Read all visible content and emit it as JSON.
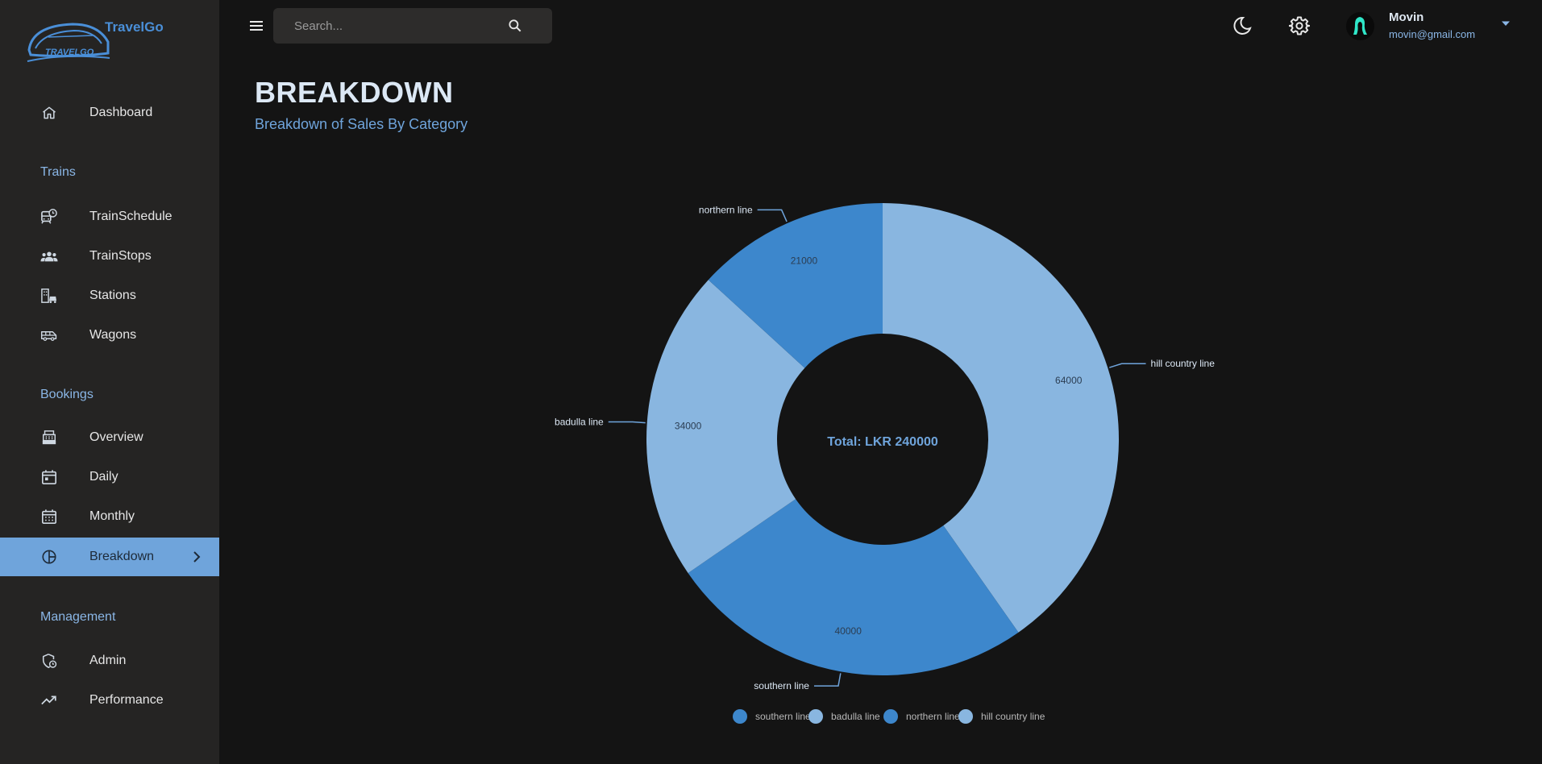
{
  "app": {
    "name": "TravelGo",
    "logo_text": "TRAVELGO"
  },
  "search": {
    "placeholder": "Search..."
  },
  "user": {
    "name": "Movin",
    "email": "movin@gmail.com"
  },
  "sidebar": {
    "dashboard": "Dashboard",
    "sections": {
      "trains": "Trains",
      "bookings": "Bookings",
      "management": "Management"
    },
    "trains_items": [
      "TrainSchedule",
      "TrainStops",
      "Stations",
      "Wagons"
    ],
    "bookings_items": [
      "Overview",
      "Daily",
      "Monthly",
      "Breakdown"
    ],
    "management_items": [
      "Admin",
      "Performance"
    ],
    "active": "Breakdown"
  },
  "header": {
    "title": "BREAKDOWN",
    "subtitle": "Breakdown of Sales By Category"
  },
  "colors": {
    "accent": "#6fa4db",
    "slice_dark": "#3d87cc",
    "slice_light": "#89b6e0",
    "background": "#141414",
    "sidebar": "#252423"
  },
  "chart_data": {
    "type": "pie",
    "donut": true,
    "center_label": "Total: LKR 240000",
    "slices": [
      {
        "label": "hill country line",
        "value": 64000,
        "color": "#89b6e0"
      },
      {
        "label": "southern line",
        "value": 40000,
        "color": "#3d87cc"
      },
      {
        "label": "badulla line",
        "value": 34000,
        "color": "#89b6e0"
      },
      {
        "label": "northern line",
        "value": 21000,
        "color": "#3d87cc"
      }
    ],
    "legend": [
      "southern line",
      "badulla line",
      "northern line",
      "hill country line"
    ],
    "legend_colors": [
      "#3d87cc",
      "#89b6e0",
      "#3d87cc",
      "#89b6e0"
    ],
    "legend_position": "bottom"
  }
}
